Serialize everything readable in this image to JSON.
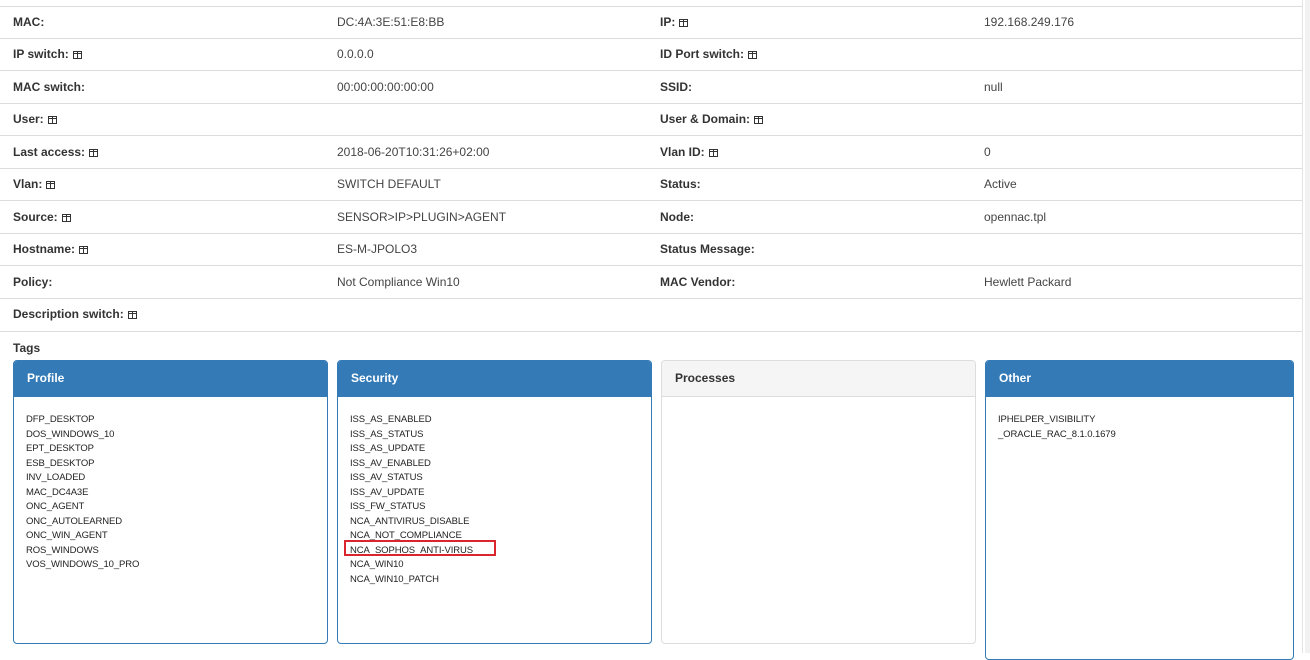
{
  "details": [
    {
      "l1": "MAC:",
      "v1": "DC:4A:3E:51:E8:BB",
      "l2": "IP:",
      "v2": "192.168.249.176",
      "i1": false,
      "i2": true
    },
    {
      "l1": "IP switch:",
      "v1": "0.0.0.0",
      "l2": "ID Port switch:",
      "v2": "",
      "i1": true,
      "i2": true
    },
    {
      "l1": "MAC switch:",
      "v1": "00:00:00:00:00:00",
      "l2": "SSID:",
      "v2": "null",
      "i1": false,
      "i2": false
    },
    {
      "l1": "User:",
      "v1": "",
      "l2": "User & Domain:",
      "v2": "",
      "i1": true,
      "i2": true
    },
    {
      "l1": "Last access:",
      "v1": "2018-06-20T10:31:26+02:00",
      "l2": "Vlan ID:",
      "v2": "0",
      "i1": true,
      "i2": true
    },
    {
      "l1": "Vlan:",
      "v1": "SWITCH DEFAULT",
      "l2": "Status:",
      "v2": "Active",
      "i1": true,
      "i2": false
    },
    {
      "l1": "Source:",
      "v1": "SENSOR>IP>PLUGIN>AGENT",
      "l2": "Node:",
      "v2": "opennac.tpl",
      "i1": true,
      "i2": false
    },
    {
      "l1": "Hostname:",
      "v1": "ES-M-JPOLO3",
      "l2": "Status Message:",
      "v2": "",
      "i1": true,
      "i2": false
    },
    {
      "l1": "Policy:",
      "v1": "Not Compliance Win10",
      "l2": "MAC Vendor:",
      "v2": "Hewlett Packard",
      "i1": false,
      "i2": false
    },
    {
      "l1": "Description switch:",
      "v1": "",
      "l2": "",
      "v2": "",
      "i1": true,
      "i2": false
    }
  ],
  "tags_label": "Tags",
  "panels": [
    {
      "title": "Profile",
      "style": "primary",
      "items": [
        "DFP_DESKTOP",
        "DOS_WINDOWS_10",
        "EPT_DESKTOP",
        "ESB_DESKTOP",
        "INV_LOADED",
        "MAC_DC4A3E",
        "ONC_AGENT",
        "ONC_AUTOLEARNED",
        "ONC_WIN_AGENT",
        "ROS_WINDOWS",
        "VOS_WINDOWS_10_PRO"
      ]
    },
    {
      "title": "Security",
      "style": "primary",
      "items": [
        "ISS_AS_ENABLED",
        "ISS_AS_STATUS",
        "ISS_AS_UPDATE",
        "ISS_AV_ENABLED",
        "ISS_AV_STATUS",
        "ISS_AV_UPDATE",
        "ISS_FW_STATUS",
        "NCA_ANTIVIRUS_DISABLE",
        "NCA_NOT_COMPLIANCE",
        "NCA_SOPHOS_ANTI-VIRUS",
        "NCA_WIN10",
        "NCA_WIN10_PATCH"
      ]
    },
    {
      "title": "Processes",
      "style": "default",
      "items": []
    },
    {
      "title": "Other",
      "style": "primary",
      "items": [
        "IPHELPER_VISIBILITY",
        "_ORACLE_RAC_8.1.0.1679"
      ]
    }
  ],
  "highlighted_tag": "NCA_SOPHOS_ANTI-VIRUS",
  "colors": {
    "primary": "#337ab7",
    "highlight": "#d9262e"
  }
}
